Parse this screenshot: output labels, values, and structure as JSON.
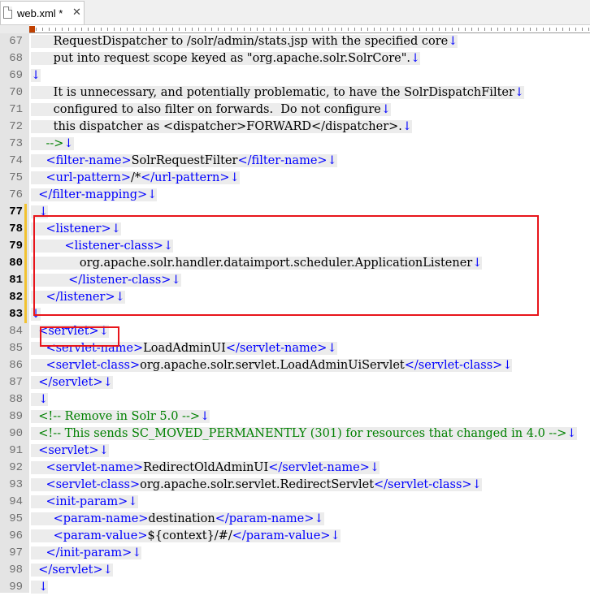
{
  "tab": {
    "label": "web.xml *",
    "close": "✕",
    "icon": "document-icon"
  },
  "colors": {
    "tag": "#0000ff",
    "text": "#000000",
    "comment": "#008000",
    "line_number": "#707070",
    "highlight_box": "#e8151b",
    "change_marker": "#f2c230"
  },
  "editor": {
    "lines": [
      {
        "n": "67",
        "mod": false,
        "indent": "      ",
        "segs": [
          [
            "t",
            "RequestDispatcher to /solr/admin/stats.jsp with the specified core"
          ]
        ]
      },
      {
        "n": "68",
        "mod": false,
        "indent": "      ",
        "segs": [
          [
            "t",
            "put into request scope keyed as \"org.apache.solr.SolrCore\"."
          ]
        ]
      },
      {
        "n": "69",
        "mod": false,
        "indent": "",
        "segs": []
      },
      {
        "n": "70",
        "mod": false,
        "indent": "      ",
        "segs": [
          [
            "t",
            "It is unnecessary, and potentially problematic, to have the SolrDispatchFilter"
          ]
        ]
      },
      {
        "n": "71",
        "mod": false,
        "indent": "      ",
        "segs": [
          [
            "t",
            "configured to also filter on forwards.  Do not configure"
          ]
        ]
      },
      {
        "n": "72",
        "mod": false,
        "indent": "      ",
        "segs": [
          [
            "t",
            "this dispatcher as <dispatcher>FORWARD</dispatcher>."
          ]
        ]
      },
      {
        "n": "73",
        "mod": false,
        "indent": "    ",
        "segs": [
          [
            "g",
            "-->"
          ]
        ]
      },
      {
        "n": "74",
        "mod": false,
        "indent": "    ",
        "segs": [
          [
            "b",
            "<filter-name>"
          ],
          [
            "t",
            "SolrRequestFilter"
          ],
          [
            "b",
            "</filter-name>"
          ]
        ]
      },
      {
        "n": "75",
        "mod": false,
        "indent": "    ",
        "segs": [
          [
            "b",
            "<url-pattern>"
          ],
          [
            "t",
            "/*"
          ],
          [
            "b",
            "</url-pattern>"
          ]
        ]
      },
      {
        "n": "76",
        "mod": false,
        "indent": "  ",
        "segs": [
          [
            "b",
            "</filter-mapping>"
          ]
        ]
      },
      {
        "n": "77",
        "mod": true,
        "indent": "  ",
        "segs": []
      },
      {
        "n": "78",
        "mod": true,
        "indent": "    ",
        "segs": [
          [
            "b",
            "<listener>"
          ]
        ]
      },
      {
        "n": "79",
        "mod": true,
        "indent": "         ",
        "segs": [
          [
            "b",
            "<listener-class>"
          ]
        ]
      },
      {
        "n": "80",
        "mod": true,
        "indent": "             ",
        "segs": [
          [
            "t",
            "org.apache.solr.handler.dataimport.scheduler.ApplicationListener"
          ]
        ]
      },
      {
        "n": "81",
        "mod": true,
        "indent": "          ",
        "segs": [
          [
            "b",
            "</listener-class>"
          ]
        ]
      },
      {
        "n": "82",
        "mod": true,
        "indent": "    ",
        "segs": [
          [
            "b",
            "</listener>"
          ]
        ]
      },
      {
        "n": "83",
        "mod": true,
        "indent": "",
        "segs": []
      },
      {
        "n": "84",
        "mod": false,
        "indent": "  ",
        "segs": [
          [
            "b",
            "<servlet>"
          ]
        ]
      },
      {
        "n": "85",
        "mod": false,
        "indent": "    ",
        "segs": [
          [
            "b",
            "<servlet-name>"
          ],
          [
            "t",
            "LoadAdminUI"
          ],
          [
            "b",
            "</servlet-name>"
          ]
        ]
      },
      {
        "n": "86",
        "mod": false,
        "indent": "    ",
        "segs": [
          [
            "b",
            "<servlet-class>"
          ],
          [
            "t",
            "org.apache.solr.servlet.LoadAdminUiServlet"
          ],
          [
            "b",
            "</servlet-class>"
          ]
        ]
      },
      {
        "n": "87",
        "mod": false,
        "indent": "  ",
        "segs": [
          [
            "b",
            "</servlet>"
          ]
        ]
      },
      {
        "n": "88",
        "mod": false,
        "indent": "  ",
        "segs": []
      },
      {
        "n": "89",
        "mod": false,
        "indent": "  ",
        "segs": [
          [
            "g",
            "<!-- Remove in Solr 5.0 -->"
          ]
        ]
      },
      {
        "n": "90",
        "mod": false,
        "indent": "  ",
        "segs": [
          [
            "g",
            "<!-- This sends SC_MOVED_PERMANENTLY (301) for resources that changed in 4.0 -->"
          ]
        ]
      },
      {
        "n": "91",
        "mod": false,
        "indent": "  ",
        "segs": [
          [
            "b",
            "<servlet>"
          ]
        ]
      },
      {
        "n": "92",
        "mod": false,
        "indent": "    ",
        "segs": [
          [
            "b",
            "<servlet-name>"
          ],
          [
            "t",
            "RedirectOldAdminUI"
          ],
          [
            "b",
            "</servlet-name>"
          ]
        ]
      },
      {
        "n": "93",
        "mod": false,
        "indent": "    ",
        "segs": [
          [
            "b",
            "<servlet-class>"
          ],
          [
            "t",
            "org.apache.solr.servlet.RedirectServlet"
          ],
          [
            "b",
            "</servlet-class>"
          ]
        ]
      },
      {
        "n": "94",
        "mod": false,
        "indent": "    ",
        "segs": [
          [
            "b",
            "<init-param>"
          ]
        ]
      },
      {
        "n": "95",
        "mod": false,
        "indent": "      ",
        "segs": [
          [
            "b",
            "<param-name>"
          ],
          [
            "t",
            "destination"
          ],
          [
            "b",
            "</param-name>"
          ]
        ]
      },
      {
        "n": "96",
        "mod": false,
        "indent": "      ",
        "segs": [
          [
            "b",
            "<param-value>"
          ],
          [
            "t",
            "${context}/#/"
          ],
          [
            "b",
            "</param-value>"
          ]
        ]
      },
      {
        "n": "97",
        "mod": false,
        "indent": "    ",
        "segs": [
          [
            "b",
            "</init-param>"
          ]
        ]
      },
      {
        "n": "98",
        "mod": false,
        "indent": "  ",
        "segs": [
          [
            "b",
            "</servlet>"
          ]
        ]
      },
      {
        "n": "99",
        "mod": false,
        "indent": "  ",
        "segs": []
      }
    ]
  }
}
